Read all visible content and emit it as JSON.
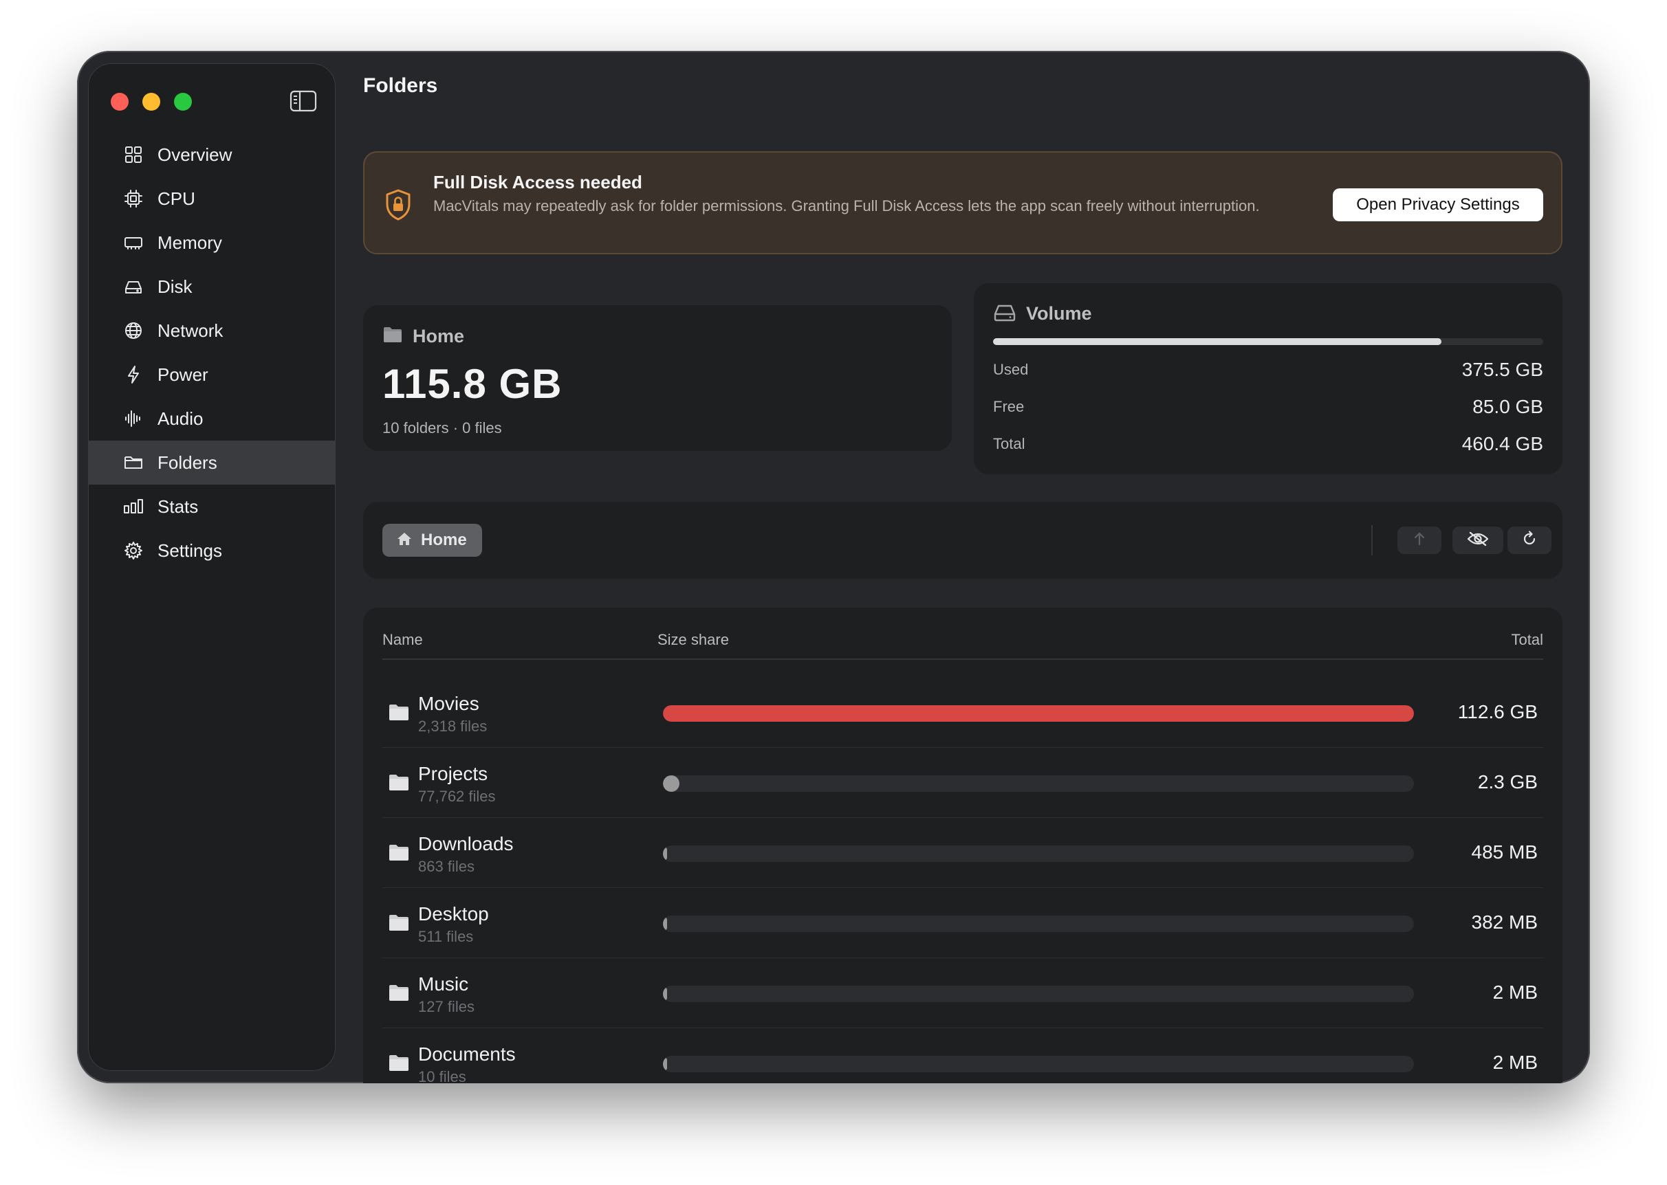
{
  "app": {
    "page_title": "Folders"
  },
  "sidebar": {
    "items": [
      {
        "label": "Overview",
        "icon": "grid-icon"
      },
      {
        "label": "CPU",
        "icon": "cpu-icon"
      },
      {
        "label": "Memory",
        "icon": "memory-icon"
      },
      {
        "label": "Disk",
        "icon": "disk-icon"
      },
      {
        "label": "Network",
        "icon": "globe-icon"
      },
      {
        "label": "Power",
        "icon": "bolt-icon"
      },
      {
        "label": "Audio",
        "icon": "waveform-icon"
      },
      {
        "label": "Folders",
        "icon": "folder-icon",
        "active": true
      },
      {
        "label": "Stats",
        "icon": "bar-chart-icon"
      },
      {
        "label": "Settings",
        "icon": "gear-icon"
      }
    ]
  },
  "banner": {
    "title": "Full Disk Access needed",
    "text": "MacVitals may repeatedly ask for folder permissions. Granting Full Disk Access lets the app scan freely without interruption.",
    "button": "Open Privacy Settings",
    "icon": "shield-lock-icon",
    "accent": "#e8943a"
  },
  "home_card": {
    "label": "Home",
    "size": "115.8 GB",
    "sub": "10 folders · 0 files",
    "icon": "folder-icon"
  },
  "volume_card": {
    "label": "Volume",
    "icon": "disk-icon",
    "used_fraction": 0.8156,
    "used_label": "Used",
    "used_value": "375.5 GB",
    "free_label": "Free",
    "free_value": "85.0 GB",
    "total_label": "Total",
    "total_value": "460.4 GB"
  },
  "toolbar": {
    "crumb": "Home",
    "crumb_icon": "house-icon",
    "buttons": [
      "arrow-up-icon",
      "eye-slash-icon",
      "refresh-icon"
    ]
  },
  "list": {
    "columns": {
      "name": "Name",
      "share": "Size share",
      "total": "Total"
    },
    "rows": [
      {
        "name": "Movies",
        "files": "2,318 files",
        "share": 1.0,
        "total": "112.6 GB",
        "color": "#d74744"
      },
      {
        "name": "Projects",
        "files": "77,762 files",
        "share": 0.0204,
        "total": "2.3 GB",
        "color": "#9a9a9a"
      },
      {
        "name": "Downloads",
        "files": "863 files",
        "share": 0.0043,
        "total": "485 MB",
        "color": "#9a9a9a"
      },
      {
        "name": "Desktop",
        "files": "511 files",
        "share": 0.0034,
        "total": "382 MB",
        "color": "#9a9a9a"
      },
      {
        "name": "Music",
        "files": "127 files",
        "share": 0.0,
        "total": "2 MB",
        "color": "#9a9a9a"
      },
      {
        "name": "Documents",
        "files": "10 files",
        "share": 0.0,
        "total": "2 MB",
        "color": "#9a9a9a"
      }
    ]
  },
  "colors": {
    "window_bg": "#25272a",
    "sidebar_bg": "#1d1e20",
    "card_bg": "#1e1f21",
    "accent_red": "#d74744",
    "banner_bg": "#3a312a"
  }
}
